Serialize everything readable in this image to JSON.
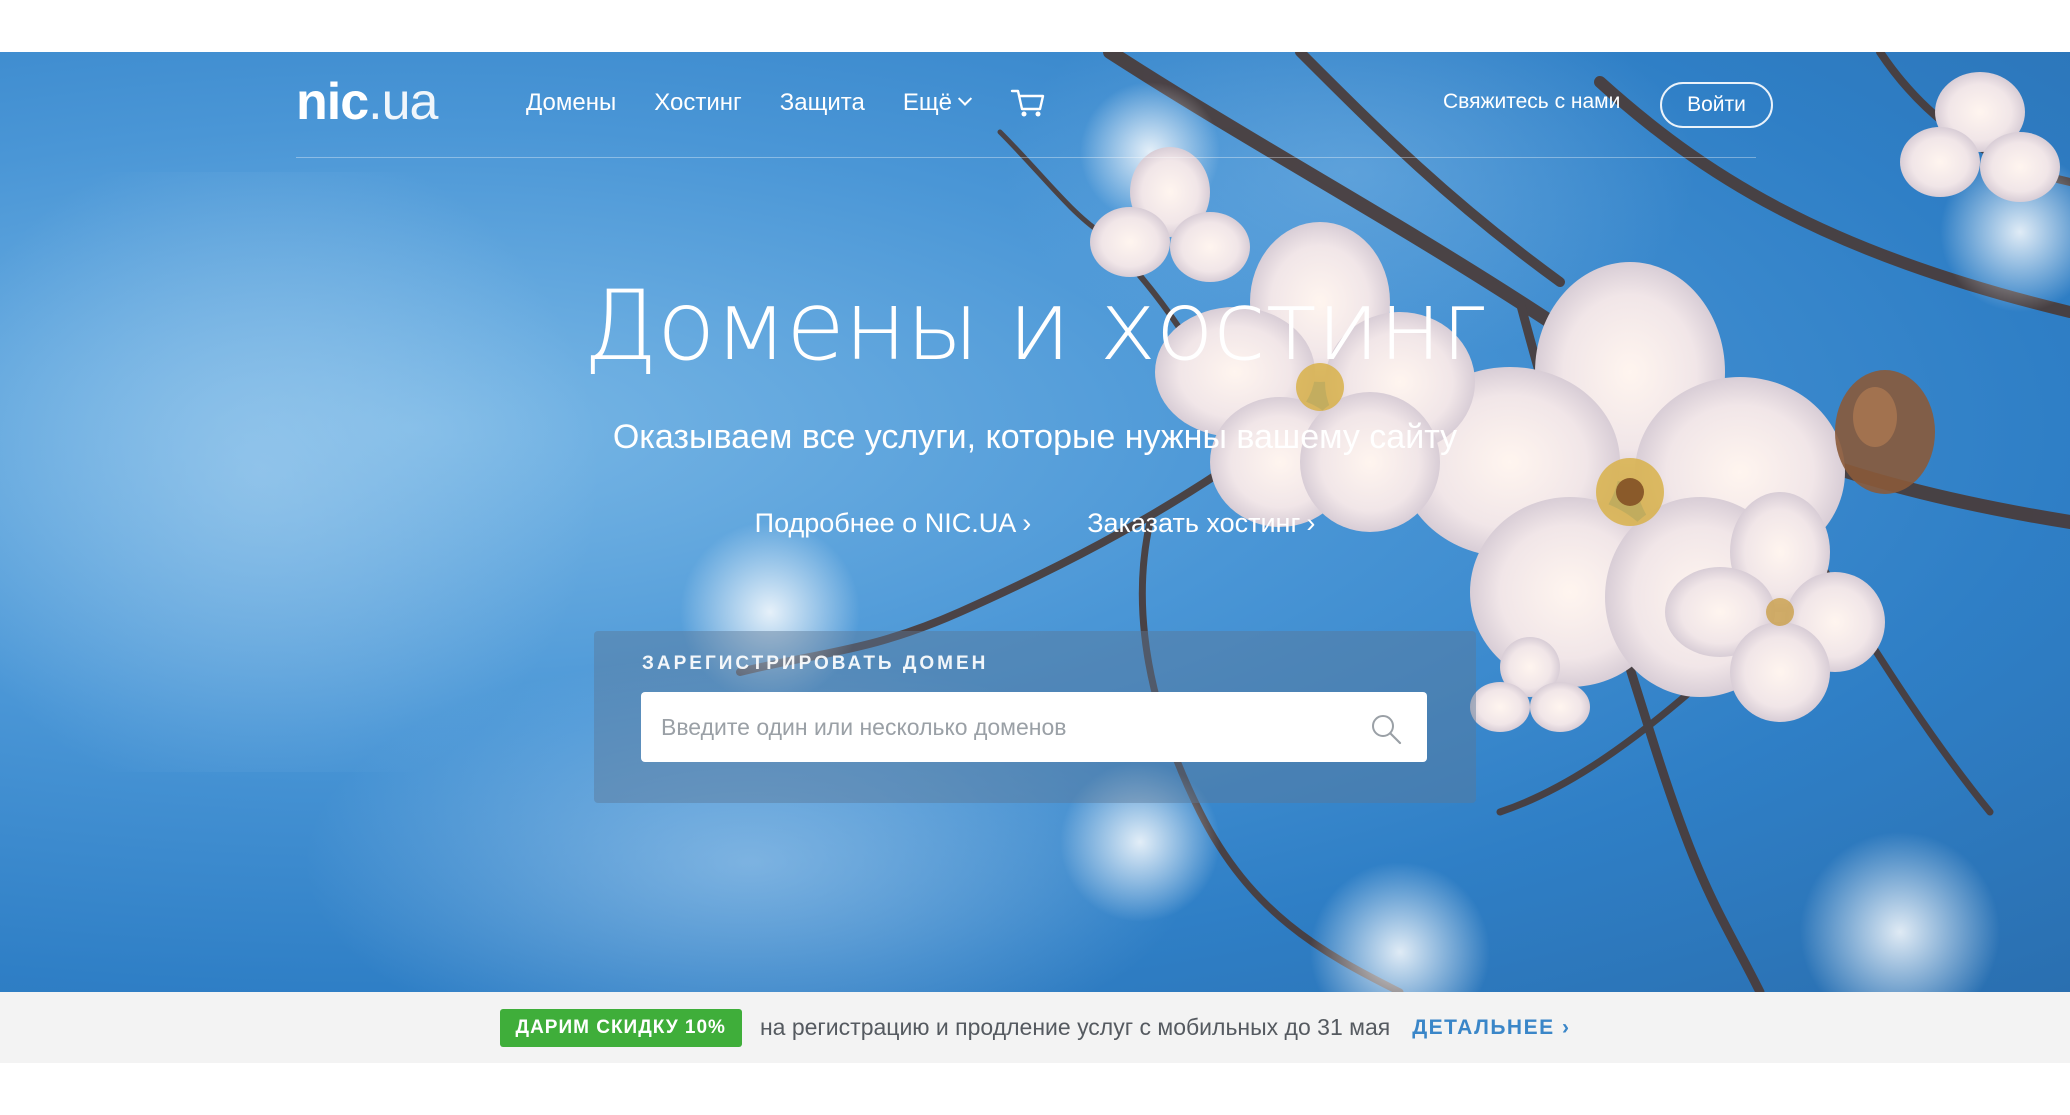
{
  "logo": {
    "bold": "nic",
    "light": ".ua"
  },
  "nav": {
    "items": [
      "Домены",
      "Хостинг",
      "Защита",
      "Ещё"
    ],
    "contact": "Свяжитесь с нами",
    "login": "Войти"
  },
  "hero": {
    "title": "Домены и хостинг",
    "subtitle": "Оказываем все услуги, которые нужны вашему сайту",
    "links": [
      "Подробнее о NIC.UA",
      "Заказать хостинг"
    ]
  },
  "search": {
    "label": "ЗАРЕГИСТРИРОВАТЬ ДОМЕН",
    "placeholder": "Введите один или несколько доменов"
  },
  "promo": {
    "badge": "ДАРИМ СКИДКУ 10%",
    "text": "на регистрацию и продление услуг с мобильных до 31 мая",
    "link": "ДЕТАЛЬНЕЕ"
  },
  "colors": {
    "hero_blue": "#3a88cc",
    "badge_green": "#3fae3a",
    "link_blue": "#3a86c8",
    "promo_bg": "#f3f3f3"
  },
  "icons": [
    "chevron-down-icon",
    "cart-icon",
    "chevron-right-icon",
    "search-icon"
  ]
}
